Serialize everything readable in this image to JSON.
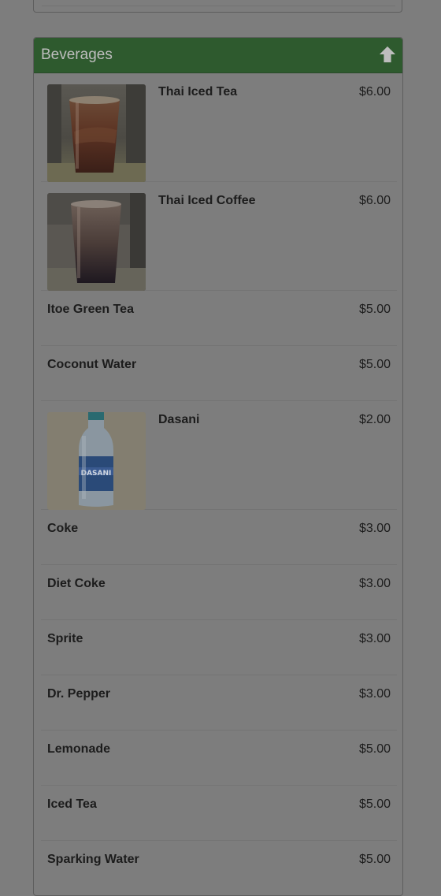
{
  "section": {
    "title": "Beverages",
    "back_to_top_icon": "arrow-up-icon"
  },
  "items": [
    {
      "name": "Thai Iced Tea",
      "price": "$6.00",
      "image": "thai-iced-tea-photo"
    },
    {
      "name": "Thai Iced Coffee",
      "price": "$6.00",
      "image": "thai-iced-coffee-photo"
    },
    {
      "name": "Itoe Green Tea",
      "price": "$5.00"
    },
    {
      "name": "Coconut Water",
      "price": "$5.00"
    },
    {
      "name": "Dasani",
      "price": "$2.00",
      "image": "dasani-bottle-photo"
    },
    {
      "name": "Coke",
      "price": "$3.00"
    },
    {
      "name": "Diet Coke",
      "price": "$3.00"
    },
    {
      "name": "Sprite",
      "price": "$3.00"
    },
    {
      "name": "Dr. Pepper",
      "price": "$3.00"
    },
    {
      "name": "Lemonade",
      "price": "$5.00"
    },
    {
      "name": "Iced Tea",
      "price": "$5.00"
    },
    {
      "name": "Sparking Water",
      "price": "$5.00"
    }
  ],
  "colors": {
    "background": "#7d7d7d",
    "heading": "#2e5a2e",
    "heading_text": "#bdbdbd",
    "item_text": "#1c1c1c"
  }
}
